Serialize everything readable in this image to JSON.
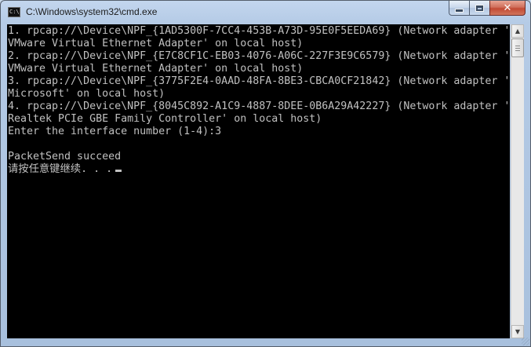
{
  "window": {
    "title": "C:\\Windows\\system32\\cmd.exe",
    "icon": "cmd-icon",
    "icon_text": "C:\\",
    "buttons": {
      "minimize": "minimize-icon",
      "maximize": "maximize-icon",
      "close": "✕"
    }
  },
  "console": {
    "background": "#000000",
    "foreground": "#c0c0c0",
    "lines": [
      "1. rpcap://\\Device\\NPF_{1AD5300F-7CC4-453B-A73D-95E0F5EEDA69} (Network adapter '",
      "VMware Virtual Ethernet Adapter' on local host)",
      "2. rpcap://\\Device\\NPF_{E7C8CF1C-EB03-4076-A06C-227F3E9C6579} (Network adapter '",
      "VMware Virtual Ethernet Adapter' on local host)",
      "3. rpcap://\\Device\\NPF_{3775F2E4-0AAD-48FA-8BE3-CBCA0CF21842} (Network adapter '",
      "Microsoft' on local host)",
      "4. rpcap://\\Device\\NPF_{8045C892-A1C9-4887-8DEE-0B6A29A42227} (Network adapter '",
      "Realtek PCIe GBE Family Controller' on local host)",
      "Enter the interface number (1-4):3",
      "",
      "PacketSend succeed",
      "请按任意键继续. . ."
    ]
  },
  "scrollbar": {
    "up": "▲",
    "down": "▼"
  }
}
